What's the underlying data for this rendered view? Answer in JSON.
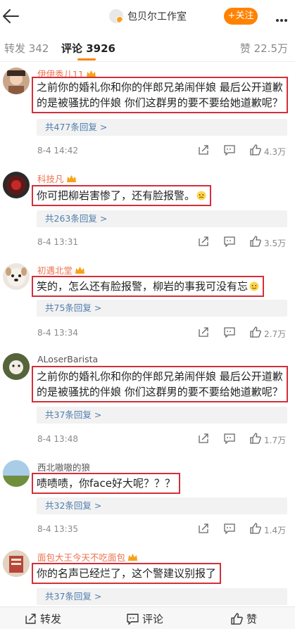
{
  "header": {
    "back_icon": "back-arrow-icon",
    "account_name": "包贝尔工作室",
    "follow_label": "+关注",
    "more_icon": "more-dots-icon",
    "accent": "#ff8200"
  },
  "tabs": {
    "repost": "转发 342",
    "comment": "评论 3926",
    "like": "赞 22.5万"
  },
  "comments": [
    {
      "user": "伊伊秀儿11",
      "text_lines": [
        "之前你的婚礼你和你的伴郎兄弟闹伴娘 最后公开道歉",
        "的是被骚扰的伴娘 你们这群男的要不要给她道歉呢？"
      ],
      "replies": "共477条回复 >",
      "time": "8-4 14:42",
      "likes": "4.3万"
    },
    {
      "user": "科技凡",
      "text_lines": [
        "你可把柳岩害惨了，还有脸报警。"
      ],
      "replies": "共263条回复 >",
      "time": "8-4 13:31",
      "likes": "3.5万"
    },
    {
      "user": "初遇北堂",
      "text_lines": [
        "笑的，怎么还有脸报警，柳岩的事我可没有忘"
      ],
      "replies": "共75条回复 >",
      "time": "8-4 13:34",
      "likes": "2.7万"
    },
    {
      "user": "ALoserBarista",
      "text_lines": [
        "之前你的婚礼你和你的伴郎兄弟闹伴娘 最后公开道歉",
        "的是被骚扰的伴娘 你们这群男的要不要给她道歉呢？"
      ],
      "replies": "共37条回复 >",
      "time": "8-4 13:48",
      "likes": "1.7万"
    },
    {
      "user": "西北嗷嗷的狼",
      "text_lines": [
        "啧啧啧，你face好大呢？？？"
      ],
      "replies": "共32条回复 >",
      "time": "8-4 13:35",
      "likes": "1.4万"
    },
    {
      "user": "面包大王今天不吃面包",
      "text_lines": [
        "你的名声已经烂了，这个警建议别报了"
      ],
      "replies": "共37条回复 >"
    }
  ],
  "bottom": {
    "repost": "转发",
    "comment": "评论",
    "like": "赞"
  }
}
